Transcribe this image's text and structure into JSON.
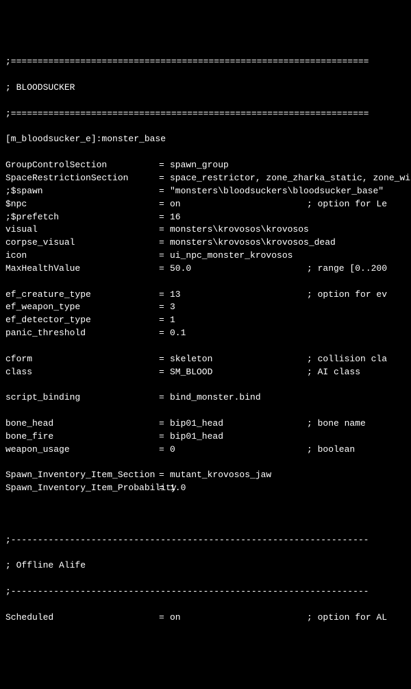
{
  "sep": ";===================================================================",
  "header": "; BLOODSUCKER",
  "section": "[m_bloodsucker_e]:monster_base",
  "lines": [
    {
      "k": "GroupControlSection",
      "e": "=",
      "v": "spawn_group",
      "c": ""
    },
    {
      "k": "SpaceRestrictionSection ",
      "e": "=",
      "v": "space_restrictor, zone_zharka_static, zone_witches",
      "c": "",
      "full": true
    },
    {
      "k": ";$spawn",
      "e": "=",
      "v": "\"monsters\\bloodsuckers\\bloodsucker_base\"",
      "c": "",
      "full": true
    },
    {
      "k": "$npc",
      "e": "=",
      "v": "on",
      "c": "; option for Le"
    },
    {
      "k": ";$prefetch",
      "e": "=",
      "v": "16",
      "c": ""
    },
    {
      "k": "visual",
      "e": "=",
      "v": "monsters\\krovosos\\krovosos",
      "c": ""
    },
    {
      "k": "corpse_visual",
      "e": "=",
      "v": "monsters\\krovosos\\krovosos_dead",
      "c": "",
      "full": true
    },
    {
      "k": "icon",
      "e": "=",
      "v": "ui_npc_monster_krovosos",
      "c": ""
    },
    {
      "k": "MaxHealthValue",
      "e": "=",
      "v": "50.0",
      "c": "; range [0..200"
    },
    {
      "blank": true
    },
    {
      "k": "ef_creature_type",
      "e": "=",
      "v": "13",
      "c": "; option for ev"
    },
    {
      "k": "ef_weapon_type",
      "e": "=",
      "v": "3",
      "c": ""
    },
    {
      "k": "ef_detector_type",
      "e": "=",
      "v": "1",
      "c": ""
    },
    {
      "k": "panic_threshold",
      "e": "=",
      "v": "0.1",
      "c": ""
    },
    {
      "blank": true
    },
    {
      "k": "cform",
      "e": "=",
      "v": "skeleton",
      "c": "; collision cla"
    },
    {
      "k": "class",
      "e": "=",
      "v": "SM_BLOOD",
      "c": "; AI class"
    },
    {
      "blank": true
    },
    {
      "k": "script_binding",
      "e": "=",
      "v": "bind_monster.bind",
      "c": ""
    },
    {
      "blank": true
    },
    {
      "k": "bone_head",
      "e": "=",
      "v": "bip01_head",
      "c": "; bone name"
    },
    {
      "k": "bone_fire",
      "e": "=",
      "v": "bip01_head",
      "c": ""
    },
    {
      "k": "weapon_usage",
      "e": "=",
      "v": "0",
      "c": "; boolean"
    },
    {
      "blank": true
    },
    {
      "k": "Spawn_Inventory_Item_Section ",
      "e": "=",
      "v": "mutant_krovosos_jaw",
      "c": "",
      "full": true
    },
    {
      "k": "Spawn_Inventory_Item_Probability ",
      "e": "=",
      "v": "1.0",
      "c": "",
      "full": true
    }
  ],
  "sep2": ";-------------------------------------------------------------------",
  "offline": "; Offline Alife",
  "sched": {
    "k": "Scheduled",
    "e": "=",
    "v": "on",
    "c": "; option for AL"
  }
}
